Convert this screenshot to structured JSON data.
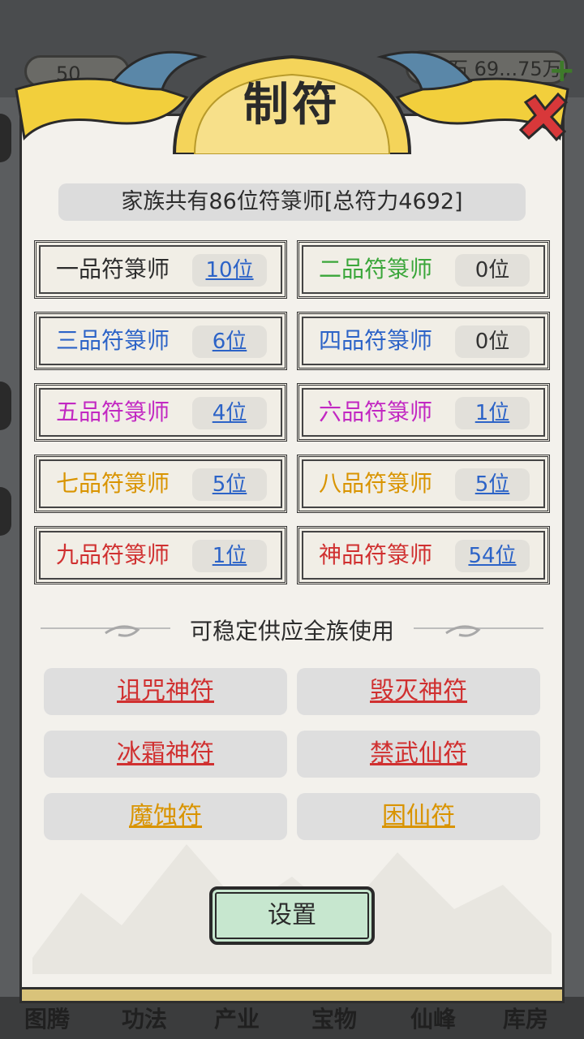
{
  "background": {
    "left_counter": "50",
    "help_glyph": "?",
    "right_counter": "69...75万",
    "right_counter_label": "石",
    "plus_glyph": "+",
    "bottom_nav": [
      "图腾",
      "功法",
      "产业",
      "宝物",
      "仙峰",
      "库房"
    ]
  },
  "header": {
    "title": "制符"
  },
  "summary": {
    "text": "家族共有86位符箓师[总符力4692]"
  },
  "ranks": [
    {
      "name": "一品符箓师",
      "count": "10位",
      "color": "#2c2c2c",
      "link": true
    },
    {
      "name": "二品符箓师",
      "count": "0位",
      "color": "#3aa63a",
      "link": false
    },
    {
      "name": "三品符箓师",
      "count": "6位",
      "color": "#2c63c7",
      "link": true
    },
    {
      "name": "四品符箓师",
      "count": "0位",
      "color": "#2c63c7",
      "link": false
    },
    {
      "name": "五品符箓师",
      "count": "4位",
      "color": "#c228c2",
      "link": true
    },
    {
      "name": "六品符箓师",
      "count": "1位",
      "color": "#c228c2",
      "link": true
    },
    {
      "name": "七品符箓师",
      "count": "5位",
      "color": "#d99400",
      "link": true
    },
    {
      "name": "八品符箓师",
      "count": "5位",
      "color": "#d99400",
      "link": true
    },
    {
      "name": "九品符箓师",
      "count": "1位",
      "color": "#d03030",
      "link": true
    },
    {
      "name": "神品符箓师",
      "count": "54位",
      "color": "#d03030",
      "link": true
    }
  ],
  "supply": {
    "heading": "可稳定供应全族使用",
    "talismans": [
      {
        "label": "诅咒神符",
        "color": "red"
      },
      {
        "label": "毁灭神符",
        "color": "red"
      },
      {
        "label": "冰霜神符",
        "color": "red"
      },
      {
        "label": "禁武仙符",
        "color": "red"
      },
      {
        "label": "魔蚀符",
        "color": "orange"
      },
      {
        "label": "困仙符",
        "color": "orange"
      }
    ]
  },
  "settings_label": "设置"
}
